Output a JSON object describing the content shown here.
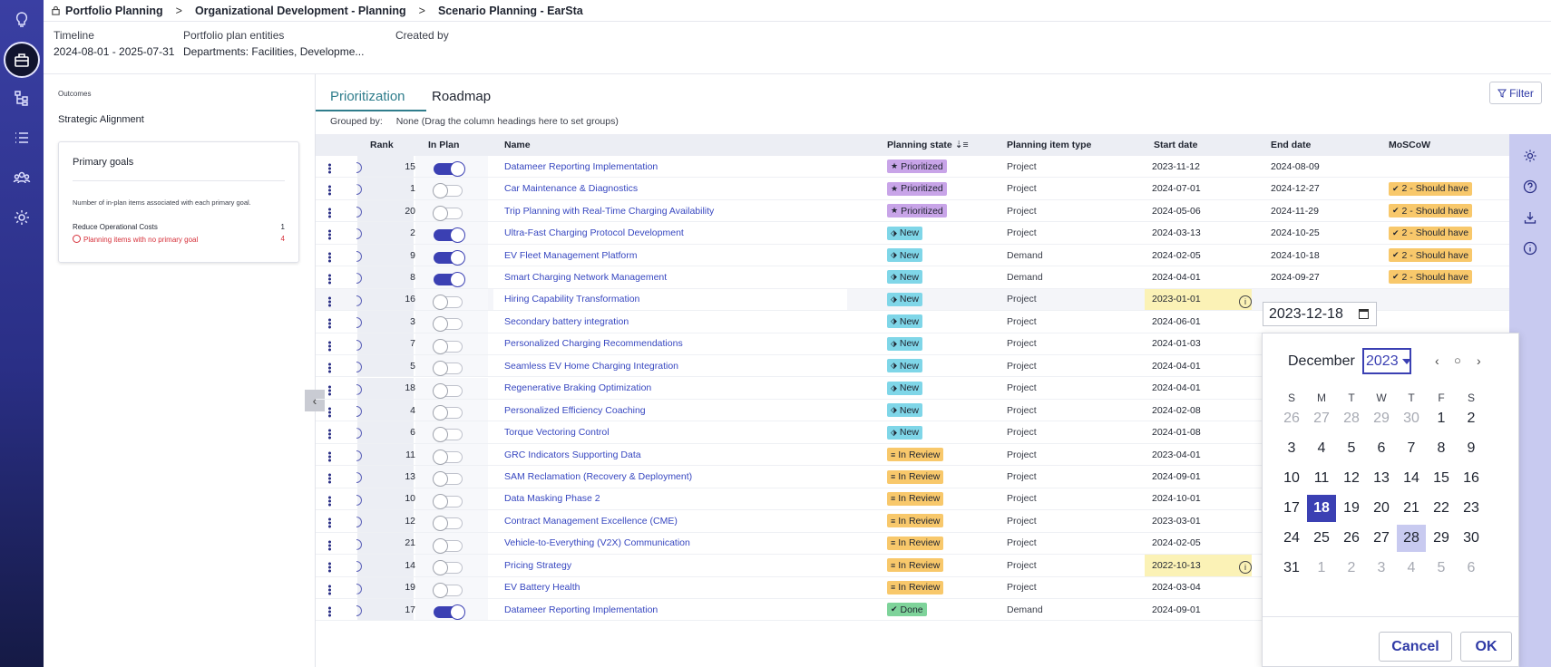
{
  "breadcrumb": {
    "items": [
      "Portfolio Planning",
      "Organizational Development - Planning",
      "Scenario Planning - EarSta"
    ],
    "separator": ">"
  },
  "header": {
    "timeline_label": "Timeline",
    "timeline_value": "2024-08-01 - 2025-07-31",
    "entities_label": "Portfolio plan entities",
    "entities_value": "Departments: Facilities, Developme...",
    "created_label": "Created by",
    "created_value": ""
  },
  "outcomes": {
    "caption": "Outcomes",
    "section": "Strategic Alignment",
    "card_title": "Primary goals",
    "card_desc": "Number of in-plan items associated with each primary goal.",
    "row1_label": "Reduce Operational Costs",
    "row1_value": "1",
    "row2_label": "Planning items with no primary goal",
    "row2_value": "4"
  },
  "tabs": {
    "prioritization": "Prioritization",
    "roadmap": "Roadmap"
  },
  "filter_label": "Filter",
  "grouped": {
    "label": "Grouped by:",
    "value": "None (Drag the column headings here to set groups)"
  },
  "columns": {
    "rank": "Rank",
    "in_plan": "In Plan",
    "name": "Name",
    "planning_state": "Planning state",
    "item_type": "Planning item type",
    "start_date": "Start date",
    "end_date": "End date",
    "moscow": "MoSCoW"
  },
  "rows": [
    {
      "rank": "15",
      "on": true,
      "name": "Datameer Reporting Implementation",
      "state": "Prioritized",
      "kind": "pri",
      "type": "Project",
      "start": "2023-11-12",
      "end": "2024-08-09",
      "moscow": ""
    },
    {
      "rank": "1",
      "on": false,
      "name": "Car Maintenance & Diagnostics",
      "state": "Prioritized",
      "kind": "pri",
      "type": "Project",
      "start": "2024-07-01",
      "end": "2024-12-27",
      "moscow": "2 - Should have"
    },
    {
      "rank": "20",
      "on": false,
      "name": "Trip Planning with Real-Time Charging Availability",
      "state": "Prioritized",
      "kind": "pri",
      "type": "Project",
      "start": "2024-05-06",
      "end": "2024-11-29",
      "moscow": "2 - Should have"
    },
    {
      "rank": "2",
      "on": true,
      "name": "Ultra-Fast Charging Protocol Development",
      "state": "New",
      "kind": "new",
      "type": "Project",
      "start": "2024-03-13",
      "end": "2024-10-25",
      "moscow": "2 - Should have"
    },
    {
      "rank": "9",
      "on": true,
      "name": "EV Fleet Management Platform",
      "state": "New",
      "kind": "new",
      "type": "Demand",
      "start": "2024-02-05",
      "end": "2024-10-18",
      "moscow": "2 - Should have"
    },
    {
      "rank": "8",
      "on": true,
      "name": "Smart Charging Network Management",
      "state": "New",
      "kind": "new",
      "type": "Demand",
      "start": "2024-04-01",
      "end": "2024-09-27",
      "moscow": "2 - Should have"
    },
    {
      "rank": "16",
      "on": false,
      "name": "Hiring Capability Transformation",
      "state": "New",
      "kind": "new",
      "type": "Project",
      "start": "2023-01-01",
      "end": "",
      "moscow": "",
      "hl": true,
      "sel": true
    },
    {
      "rank": "3",
      "on": false,
      "name": "Secondary battery integration",
      "state": "New",
      "kind": "new",
      "type": "Project",
      "start": "2024-06-01",
      "end": "",
      "moscow": ""
    },
    {
      "rank": "7",
      "on": false,
      "name": "Personalized Charging Recommendations",
      "state": "New",
      "kind": "new",
      "type": "Project",
      "start": "2024-01-03",
      "end": "",
      "moscow": ""
    },
    {
      "rank": "5",
      "on": false,
      "name": "Seamless EV Home Charging Integration",
      "state": "New",
      "kind": "new",
      "type": "Project",
      "start": "2024-04-01",
      "end": "",
      "moscow": ""
    },
    {
      "rank": "18",
      "on": false,
      "name": "Regenerative Braking Optimization",
      "state": "New",
      "kind": "new",
      "type": "Project",
      "start": "2024-04-01",
      "end": "",
      "moscow": ""
    },
    {
      "rank": "4",
      "on": false,
      "name": "Personalized Efficiency Coaching",
      "state": "New",
      "kind": "new",
      "type": "Project",
      "start": "2024-02-08",
      "end": "",
      "moscow": ""
    },
    {
      "rank": "6",
      "on": false,
      "name": "Torque Vectoring Control",
      "state": "New",
      "kind": "new",
      "type": "Project",
      "start": "2024-01-08",
      "end": "",
      "moscow": ""
    },
    {
      "rank": "11",
      "on": false,
      "name": "GRC Indicators Supporting Data",
      "state": "In Review",
      "kind": "rev",
      "type": "Project",
      "start": "2023-04-01",
      "end": "",
      "moscow": ""
    },
    {
      "rank": "13",
      "on": false,
      "name": "SAM Reclamation (Recovery & Deployment)",
      "state": "In Review",
      "kind": "rev",
      "type": "Project",
      "start": "2024-09-01",
      "end": "",
      "moscow": ""
    },
    {
      "rank": "10",
      "on": false,
      "name": "Data Masking Phase 2",
      "state": "In Review",
      "kind": "rev",
      "type": "Project",
      "start": "2024-10-01",
      "end": "",
      "moscow": ""
    },
    {
      "rank": "12",
      "on": false,
      "name": "Contract Management Excellence (CME)",
      "state": "In Review",
      "kind": "rev",
      "type": "Project",
      "start": "2023-03-01",
      "end": "",
      "moscow": ""
    },
    {
      "rank": "21",
      "on": false,
      "name": "Vehicle-to-Everything (V2X) Communication",
      "state": "In Review",
      "kind": "rev",
      "type": "Project",
      "start": "2024-02-05",
      "end": "",
      "moscow": ""
    },
    {
      "rank": "14",
      "on": false,
      "name": "Pricing Strategy",
      "state": "In Review",
      "kind": "rev",
      "type": "Project",
      "start": "2022-10-13",
      "end": "",
      "moscow": "",
      "hl": true
    },
    {
      "rank": "19",
      "on": false,
      "name": "EV Battery Health",
      "state": "In Review",
      "kind": "rev",
      "type": "Project",
      "start": "2024-03-04",
      "end": "",
      "moscow": ""
    },
    {
      "rank": "17",
      "on": true,
      "name": "Datameer Reporting Implementation",
      "state": "Done",
      "kind": "done",
      "type": "Demand",
      "start": "2024-09-01",
      "end": "",
      "moscow": ""
    }
  ],
  "date_input": {
    "value": "2023-12-18"
  },
  "calendar": {
    "month": "December",
    "year": "2023",
    "weekdays": [
      "S",
      "M",
      "T",
      "W",
      "T",
      "F",
      "S"
    ],
    "days": [
      "26",
      "27",
      "28",
      "29",
      "30",
      "1",
      "2",
      "3",
      "4",
      "5",
      "6",
      "7",
      "8",
      "9",
      "10",
      "11",
      "12",
      "13",
      "14",
      "15",
      "16",
      "17",
      "18",
      "19",
      "20",
      "21",
      "22",
      "23",
      "24",
      "25",
      "26",
      "27",
      "28",
      "29",
      "30",
      "31",
      "1",
      "2",
      "3",
      "4",
      "5",
      "6"
    ],
    "selected": "18",
    "hovered": "28",
    "cancel": "Cancel",
    "ok": "OK"
  },
  "colors": {
    "rail": "#3a3fa3",
    "accent": "#3b40b3",
    "teal": "#2f7d8c"
  }
}
